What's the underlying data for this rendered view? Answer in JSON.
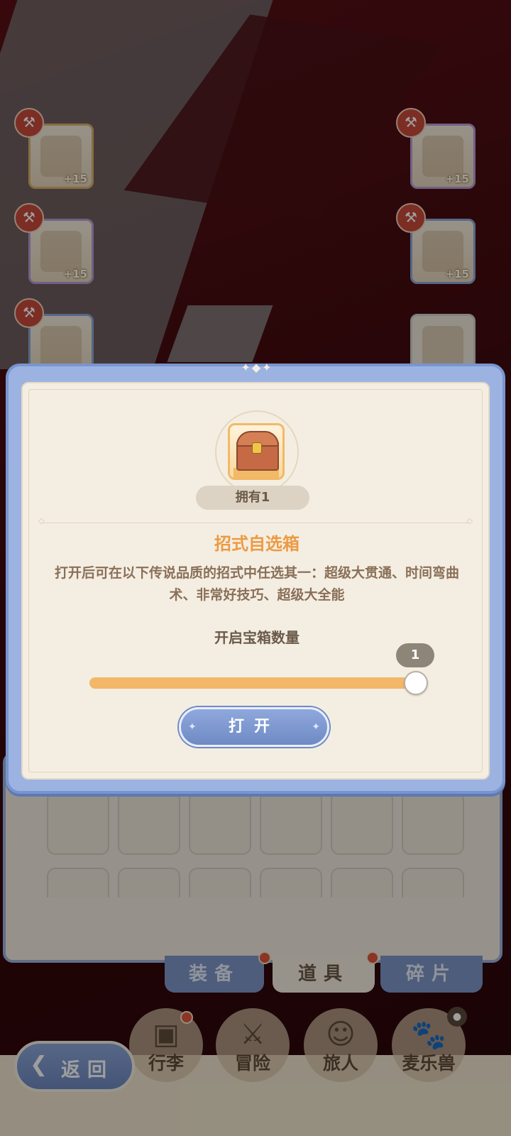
{
  "equipment_slots": [
    {
      "level": "+15",
      "icon": "bow-icon"
    },
    {
      "level": "+15",
      "icon": "helmet-icon"
    },
    {
      "level": "+15",
      "icon": "armor-icon"
    },
    {
      "level": "+15",
      "icon": "gauntlet-icon"
    },
    {
      "level": "",
      "icon": "pants-icon"
    },
    {
      "level": "",
      "icon": "boots-icon"
    }
  ],
  "modal": {
    "owned_label": "拥有1",
    "item_name": "招式自选箱",
    "item_description": "打开后可在以下传说品质的招式中任选其一：超级大贯通、时间弯曲术、非常好技巧、超级大全能",
    "quantity_label": "开启宝箱数量",
    "quantity_value": "1",
    "quantity_fraction": 1.0,
    "open_button": "打开",
    "icon": "treasure-chest-icon"
  },
  "inventory_tabs": [
    {
      "label": "装备",
      "active": false,
      "badge": true
    },
    {
      "label": "道具",
      "active": true,
      "badge": true
    },
    {
      "label": "碎片",
      "active": false,
      "badge": false
    }
  ],
  "bottom_nav": {
    "back_label": "返回",
    "items": [
      {
        "label": "行李",
        "icon": "luggage-icon",
        "badge": true
      },
      {
        "label": "冒险",
        "icon": "crossed-swords-icon",
        "badge": false
      },
      {
        "label": "旅人",
        "icon": "traveler-icon",
        "badge": false
      },
      {
        "label": "麦乐兽",
        "icon": "pet-icon",
        "badge": false,
        "locked": true
      }
    ]
  },
  "colors": {
    "accent_blue": "#8fa8dd",
    "title_orange": "#ec9a43",
    "slider_fill": "#f2b768",
    "badge_red": "#e0563a"
  }
}
